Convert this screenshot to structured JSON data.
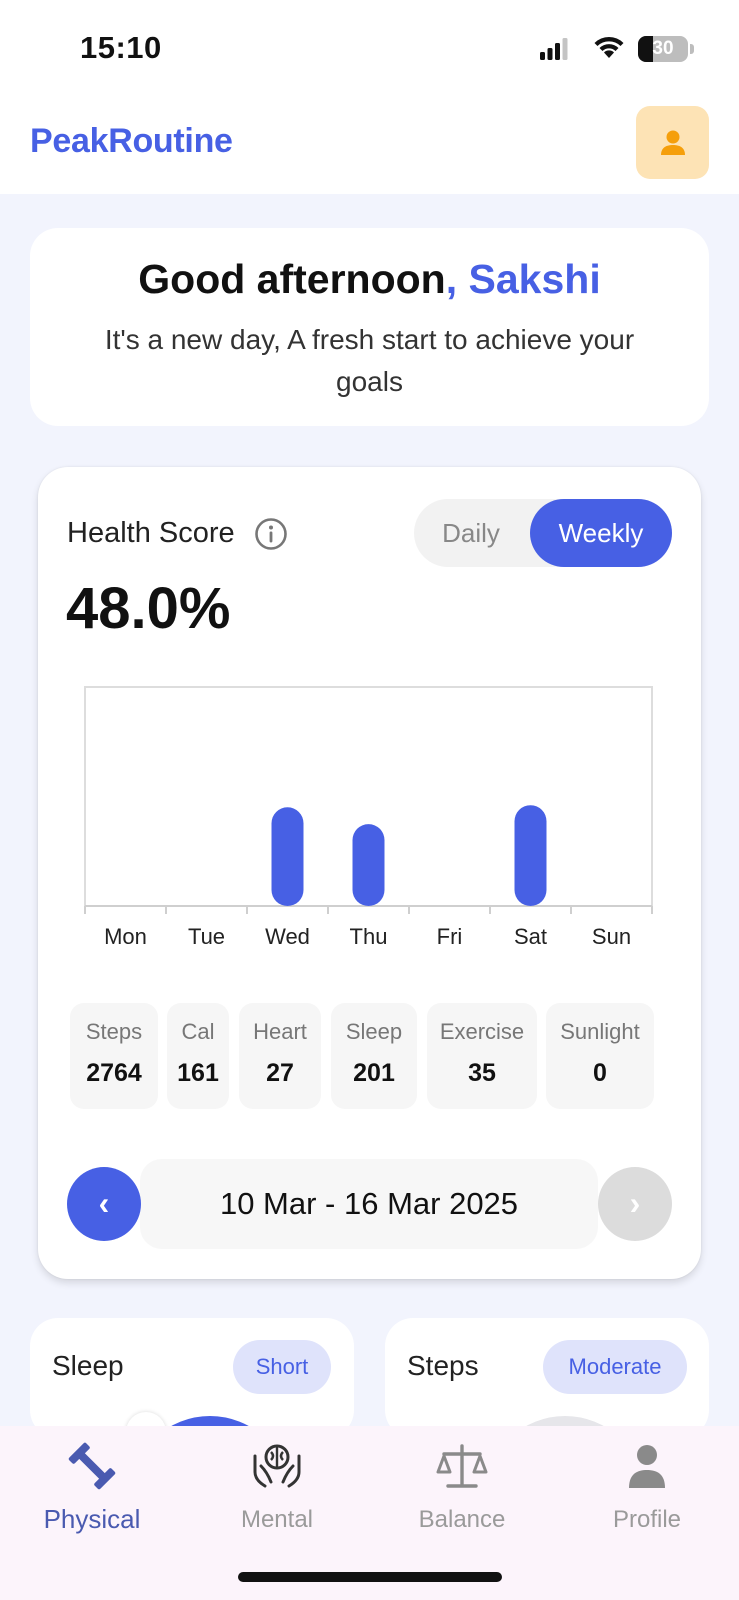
{
  "status_bar": {
    "time": "15:10",
    "battery": "30",
    "battery_level": 0.3
  },
  "header": {
    "app_title": "PeakRoutine"
  },
  "greeting": {
    "title": "Good afternoon",
    "name": ", Sakshi",
    "subtitle": "It's a new day, A fresh start to achieve your goals"
  },
  "health_score": {
    "label": "Health Score",
    "value": "48.0%",
    "toggle": {
      "daily": "Daily",
      "weekly": "Weekly",
      "selected": "weekly"
    }
  },
  "chart_data": {
    "type": "bar",
    "categories": [
      "Mon",
      "Tue",
      "Wed",
      "Thu",
      "Fri",
      "Sat",
      "Sun"
    ],
    "values": [
      0,
      0,
      47,
      39,
      0,
      48,
      0
    ],
    "ylim": [
      0,
      100
    ],
    "bar_color": "#4760e4",
    "grid": false
  },
  "metrics": [
    {
      "label": "Steps",
      "value": "2764"
    },
    {
      "label": "Cal",
      "value": "161"
    },
    {
      "label": "Heart",
      "value": "27"
    },
    {
      "label": "Sleep",
      "value": "201"
    },
    {
      "label": "Exercise",
      "value": "35"
    },
    {
      "label": "Sunlight",
      "value": "0"
    }
  ],
  "week_nav": {
    "range": "10 Mar - 16 Mar 2025",
    "prev": "‹",
    "next": "›"
  },
  "cards": {
    "sleep": {
      "title": "Sleep",
      "badge": "Short"
    },
    "steps": {
      "title": "Steps",
      "badge": "Moderate"
    }
  },
  "tabs": [
    {
      "label": "Physical",
      "icon": "dumbbell-icon",
      "active": true
    },
    {
      "label": "Mental",
      "icon": "brain-hands-icon",
      "active": false
    },
    {
      "label": "Balance",
      "icon": "scale-icon",
      "active": false
    },
    {
      "label": "Profile",
      "icon": "person-icon",
      "active": false
    }
  ],
  "colors": {
    "accent": "#4760e4",
    "avatar_bg": "#fde3b5",
    "avatar_icon": "#f59f0b"
  }
}
